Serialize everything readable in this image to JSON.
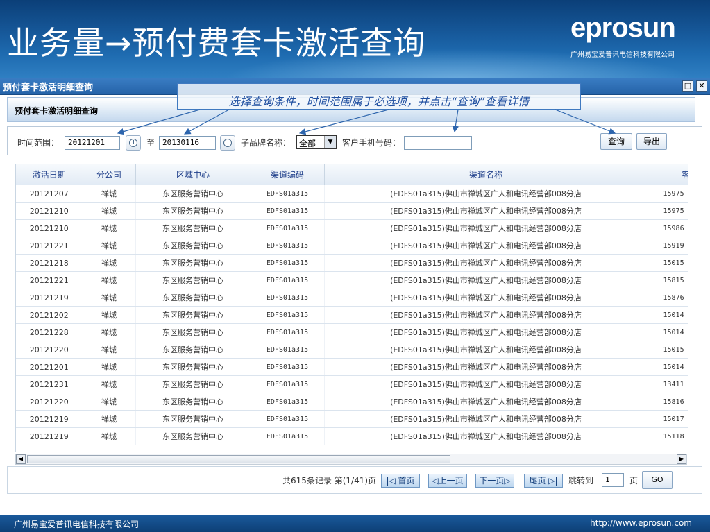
{
  "slide": {
    "title": "业务量→预付费套卡激活查询",
    "brand": "eprosun",
    "brand_sub": "广州易宝爱普讯电信科技有限公司"
  },
  "window": {
    "title": "预付套卡激活明细查询",
    "panel_title": "预付套卡激活明细查询"
  },
  "callout": "选择查询条件，时间范围属于必选项，并点击“查询”查看详情",
  "filters": {
    "time_label": "时间范围：",
    "start_date": "20121201",
    "to_label": "至",
    "end_date": "20130116",
    "brand_label": "子品牌名称：",
    "brand_value": "全部",
    "phone_label": "客户手机号码：",
    "phone_value": "",
    "query_button": "查询",
    "export_button": "导出"
  },
  "table": {
    "columns": [
      "激活日期",
      "分公司",
      "区域中心",
      "渠道编码",
      "渠道名称",
      "客户手"
    ],
    "rows": [
      [
        "20121207",
        "禅城",
        "东区服务营销中心",
        "EDFS01a315",
        "(EDFS01a315)佛山市禅城区广人和电讯经营部008分店",
        "15975"
      ],
      [
        "20121210",
        "禅城",
        "东区服务营销中心",
        "EDFS01a315",
        "(EDFS01a315)佛山市禅城区广人和电讯经营部008分店",
        "15975"
      ],
      [
        "20121210",
        "禅城",
        "东区服务营销中心",
        "EDFS01a315",
        "(EDFS01a315)佛山市禅城区广人和电讯经营部008分店",
        "15986"
      ],
      [
        "20121221",
        "禅城",
        "东区服务营销中心",
        "EDFS01a315",
        "(EDFS01a315)佛山市禅城区广人和电讯经营部008分店",
        "15919"
      ],
      [
        "20121218",
        "禅城",
        "东区服务营销中心",
        "EDFS01a315",
        "(EDFS01a315)佛山市禅城区广人和电讯经营部008分店",
        "15015"
      ],
      [
        "20121221",
        "禅城",
        "东区服务营销中心",
        "EDFS01a315",
        "(EDFS01a315)佛山市禅城区广人和电讯经营部008分店",
        "15815"
      ],
      [
        "20121219",
        "禅城",
        "东区服务营销中心",
        "EDFS01a315",
        "(EDFS01a315)佛山市禅城区广人和电讯经营部008分店",
        "15876"
      ],
      [
        "20121202",
        "禅城",
        "东区服务营销中心",
        "EDFS01a315",
        "(EDFS01a315)佛山市禅城区广人和电讯经营部008分店",
        "15014"
      ],
      [
        "20121228",
        "禅城",
        "东区服务营销中心",
        "EDFS01a315",
        "(EDFS01a315)佛山市禅城区广人和电讯经营部008分店",
        "15014"
      ],
      [
        "20121220",
        "禅城",
        "东区服务营销中心",
        "EDFS01a315",
        "(EDFS01a315)佛山市禅城区广人和电讯经营部008分店",
        "15015"
      ],
      [
        "20121201",
        "禅城",
        "东区服务营销中心",
        "EDFS01a315",
        "(EDFS01a315)佛山市禅城区广人和电讯经营部008分店",
        "15014"
      ],
      [
        "20121231",
        "禅城",
        "东区服务营销中心",
        "EDFS01a315",
        "(EDFS01a315)佛山市禅城区广人和电讯经营部008分店",
        "13411"
      ],
      [
        "20121220",
        "禅城",
        "东区服务营销中心",
        "EDFS01a315",
        "(EDFS01a315)佛山市禅城区广人和电讯经营部008分店",
        "15816"
      ],
      [
        "20121219",
        "禅城",
        "东区服务营销中心",
        "EDFS01a315",
        "(EDFS01a315)佛山市禅城区广人和电讯经营部008分店",
        "15017"
      ],
      [
        "20121219",
        "禅城",
        "东区服务营销中心",
        "EDFS01a315",
        "(EDFS01a315)佛山市禅城区广人和电讯经营部008分店",
        "15118"
      ]
    ]
  },
  "pager": {
    "summary": "共615条记录 第(1/41)页",
    "first": "|◁ 首页",
    "prev": "◁上一页",
    "next": "下一页▷",
    "last": "尾页 ▷|",
    "jump_label": "跳转到",
    "page_value": "1",
    "page_unit": "页",
    "go": "GO"
  },
  "footer": {
    "company": "广州易宝爱普讯电信科技有限公司",
    "url": "http://www.eprosun.com"
  },
  "colors": {
    "header_blue": "#175a9c",
    "header_text": "#1f3f8a",
    "callout_text": "#1f4fa0"
  }
}
